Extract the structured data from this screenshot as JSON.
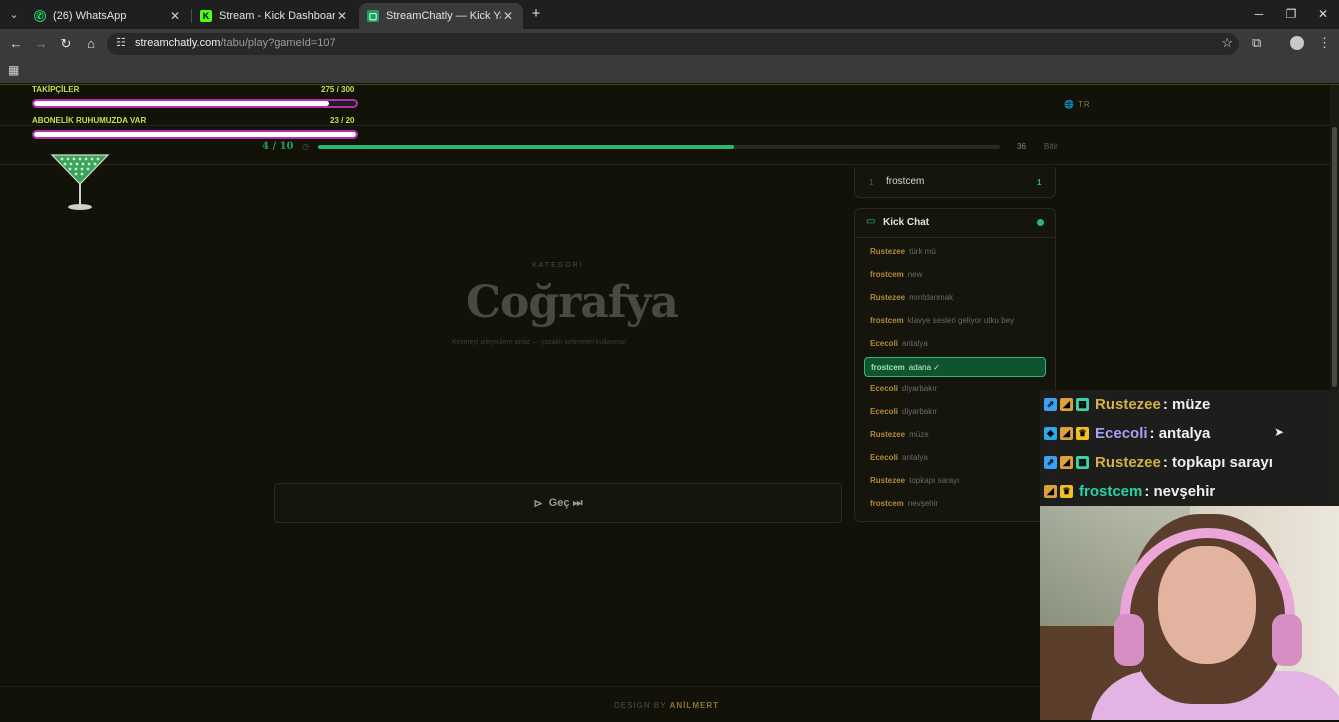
{
  "browser": {
    "tabs": [
      {
        "title": "(26) WhatsApp",
        "icon": "whatsapp-icon",
        "active": false
      },
      {
        "title": "Stream - Kick Dashboard",
        "icon": "kick-icon",
        "active": false
      },
      {
        "title": "StreamChatly — Kick Yayıncılar",
        "icon": "streamchatly-icon",
        "active": true
      }
    ],
    "url_host": "streamchatly.com",
    "url_path": "/tabu/play?gameId=107"
  },
  "overlay_goals": {
    "followers": {
      "label": "TAKİPÇİLER",
      "value": "275 / 300",
      "fraction": 0.917
    },
    "subs": {
      "label": "ABONELİK RUHUMUZDA VAR",
      "value": "23 / 20",
      "fraction": 1.0
    }
  },
  "game": {
    "language": "TR",
    "question_counter": "4 / 10",
    "timer": "36",
    "finish_label": "Bitir",
    "progress": 0.61,
    "category_label": "KATEGORİ",
    "category": "Coğrafya",
    "hint": "Kelimeyi izleyicilere anlat — yasaklı kelimeleri kullanma!",
    "skip_label": "Geç ⏭"
  },
  "leaderboard": [
    {
      "rank": "1",
      "name": "frostcem",
      "score": "1"
    }
  ],
  "kick_chat": {
    "title": "Kick Chat",
    "messages": [
      {
        "user": "Rustezee",
        "text": "türk mü"
      },
      {
        "user": "frostcem",
        "text": "new"
      },
      {
        "user": "Rustezee",
        "text": "mırıldanmak"
      },
      {
        "user": "frostcem",
        "text": "klavye sesleri geliyor utku bey"
      },
      {
        "user": "Ececoli",
        "text": "antalya"
      },
      {
        "user": "frostcem",
        "text": "adana ✓",
        "highlight": true
      },
      {
        "user": "Ececoli",
        "text": "diyarbakır"
      },
      {
        "user": "Ececoli",
        "text": "diyarbakır"
      },
      {
        "user": "Rustezee",
        "text": "müze"
      },
      {
        "user": "Ececoli",
        "text": "antalya"
      },
      {
        "user": "Rustezee",
        "text": "topkapı sarayı"
      },
      {
        "user": "frostcem",
        "text": "nevşehir"
      }
    ]
  },
  "footer": {
    "prefix": "DESIGN BY",
    "author": "ANİLMERT"
  },
  "overlay_chat": [
    {
      "user": "Rustezee",
      "text": ": müze",
      "color": "#d4b04a"
    },
    {
      "user": "Ececoli",
      "text": ": antalya",
      "color": "#a7a2f5"
    },
    {
      "user": "Rustezee",
      "text": ": topkapı sarayı",
      "color": "#d4b04a"
    },
    {
      "user": "frostcem",
      "text": ": nevşehir",
      "color": "#2bd1a7"
    }
  ],
  "colors": {
    "accent_green": "#2bb673",
    "goal_text": "#c8e04a",
    "goal_border": "#b030b0",
    "chat_user": "#b0893a"
  }
}
